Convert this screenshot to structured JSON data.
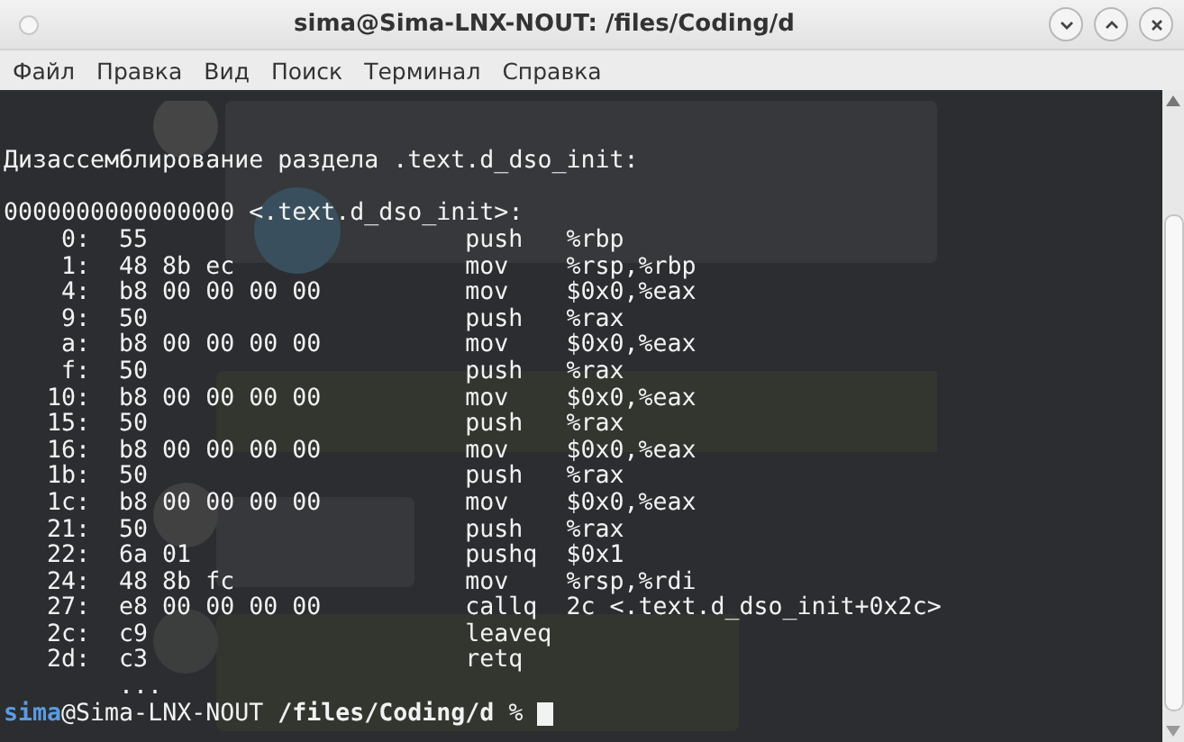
{
  "window": {
    "title": "sima@Sima-LNX-NOUT: /files/Coding/d"
  },
  "menu": [
    "Файл",
    "Правка",
    "Вид",
    "Поиск",
    "Терминал",
    "Справка"
  ],
  "terminal": {
    "heading": "Дизассемблирование раздела .text.d_dso_init:",
    "symbol": "0000000000000000 <.text.d_dso_init>:",
    "instructions": [
      {
        "addr": "0:",
        "bytes": "55",
        "mnemonic": "push",
        "operands": "%rbp"
      },
      {
        "addr": "1:",
        "bytes": "48 8b ec",
        "mnemonic": "mov",
        "operands": "%rsp,%rbp"
      },
      {
        "addr": "4:",
        "bytes": "b8 00 00 00 00",
        "mnemonic": "mov",
        "operands": "$0x0,%eax"
      },
      {
        "addr": "9:",
        "bytes": "50",
        "mnemonic": "push",
        "operands": "%rax"
      },
      {
        "addr": "a:",
        "bytes": "b8 00 00 00 00",
        "mnemonic": "mov",
        "operands": "$0x0,%eax"
      },
      {
        "addr": "f:",
        "bytes": "50",
        "mnemonic": "push",
        "operands": "%rax"
      },
      {
        "addr": "10:",
        "bytes": "b8 00 00 00 00",
        "mnemonic": "mov",
        "operands": "$0x0,%eax"
      },
      {
        "addr": "15:",
        "bytes": "50",
        "mnemonic": "push",
        "operands": "%rax"
      },
      {
        "addr": "16:",
        "bytes": "b8 00 00 00 00",
        "mnemonic": "mov",
        "operands": "$0x0,%eax"
      },
      {
        "addr": "1b:",
        "bytes": "50",
        "mnemonic": "push",
        "operands": "%rax"
      },
      {
        "addr": "1c:",
        "bytes": "b8 00 00 00 00",
        "mnemonic": "mov",
        "operands": "$0x0,%eax"
      },
      {
        "addr": "21:",
        "bytes": "50",
        "mnemonic": "push",
        "operands": "%rax"
      },
      {
        "addr": "22:",
        "bytes": "6a 01",
        "mnemonic": "pushq",
        "operands": "$0x1"
      },
      {
        "addr": "24:",
        "bytes": "48 8b fc",
        "mnemonic": "mov",
        "operands": "%rsp,%rdi"
      },
      {
        "addr": "27:",
        "bytes": "e8 00 00 00 00",
        "mnemonic": "callq",
        "operands": "2c <.text.d_dso_init+0x2c>"
      },
      {
        "addr": "2c:",
        "bytes": "c9",
        "mnemonic": "leaveq"
      },
      {
        "addr": "2d:",
        "bytes": "c3",
        "mnemonic": "retq"
      }
    ],
    "ellipsis": "...",
    "prompt": {
      "user": "sima",
      "host": "@Sima-LNX-NOUT",
      "path": "/files/Coding/d",
      "symbol": "%"
    }
  }
}
